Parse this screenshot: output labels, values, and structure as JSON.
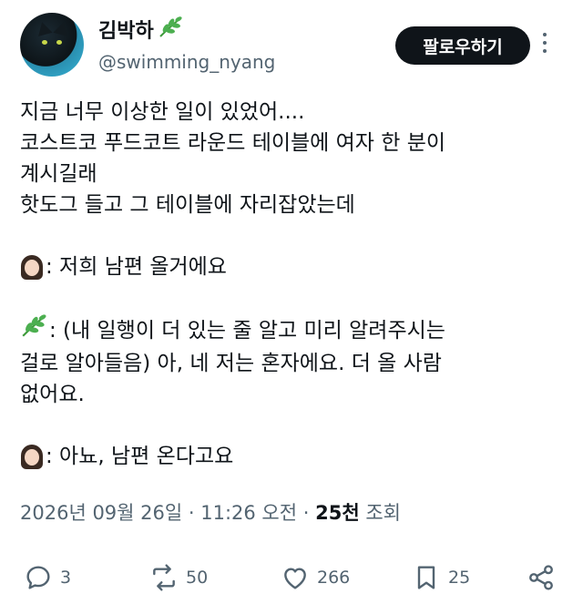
{
  "author": {
    "display_name": "김박하",
    "handle": "@swimming_nyang"
  },
  "follow_button": "팔로우하기",
  "tweet_lines": [
    {
      "emoji": null,
      "text": "지금 너무 이상한 일이 있었어...."
    },
    {
      "emoji": null,
      "text": "코스트코 푸드코트 라운드 테이블에 여자 한 분이"
    },
    {
      "emoji": null,
      "text": "계시길래"
    },
    {
      "emoji": null,
      "text": "핫도그 들고 그 테이블에 자리잡았는데"
    },
    {
      "emoji": null,
      "text": ""
    },
    {
      "emoji": "woman-icon",
      "text": ": 저희 남편 올거에요"
    },
    {
      "emoji": null,
      "text": ""
    },
    {
      "emoji": "herb-icon",
      "text": ": (내 일행이 더 있는 줄 알고 미리 알려주시는"
    },
    {
      "emoji": null,
      "text": "걸로 알아들음) 아, 네 저는 혼자에요. 더 올 사람"
    },
    {
      "emoji": null,
      "text": "없어요."
    },
    {
      "emoji": null,
      "text": ""
    },
    {
      "emoji": "woman-icon",
      "text": ": 아뇨, 남편 온다고요"
    }
  ],
  "meta": {
    "datetime": "2026년 09월 26일 · 11:26 오전 · ",
    "views_count": "25천",
    "views_label": " 조회"
  },
  "actions": {
    "replies": "3",
    "retweets": "50",
    "likes": "266",
    "bookmarks": "25"
  },
  "colors": {
    "text": "#0f1419",
    "secondary": "#536471",
    "follow_bg": "#0f1419",
    "herb": "#3d9a3a"
  }
}
